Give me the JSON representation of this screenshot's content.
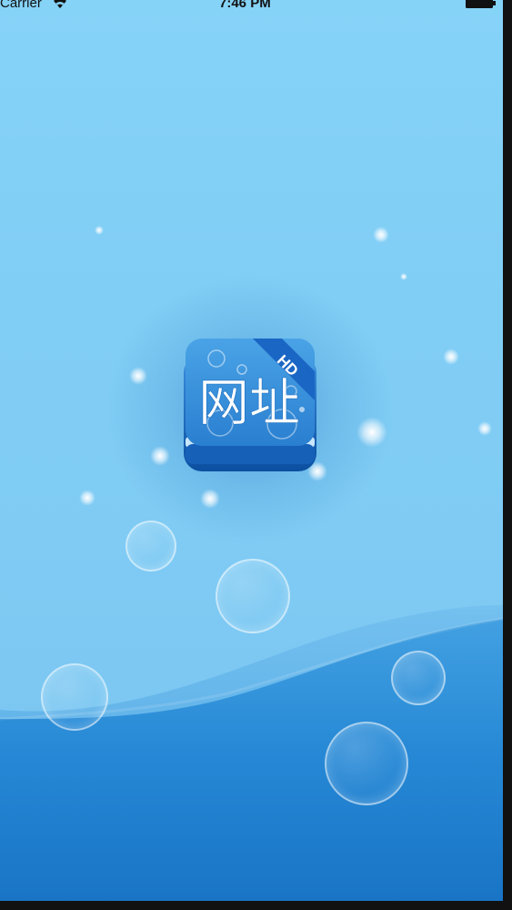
{
  "status_bar": {
    "carrier": "Carrier",
    "time": "7:46 PM",
    "wifi_icon": "wifi-icon",
    "battery_icon": "battery-icon"
  },
  "splash": {
    "app_icon": {
      "title_text": "网址",
      "badge_text": "HD"
    }
  },
  "colors": {
    "sky_top": "#86d3f8",
    "wave_light": "#5fb4ea",
    "wave_dark": "#1f7fd0",
    "icon_blue": "#2a86d6"
  }
}
